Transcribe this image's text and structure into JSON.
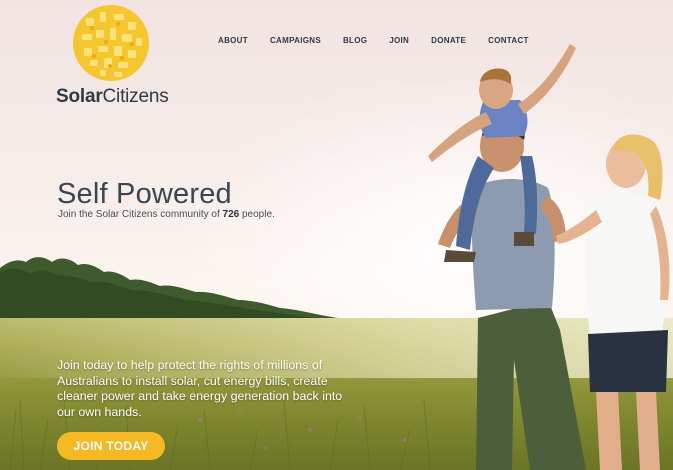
{
  "brand": {
    "name_bold": "Solar",
    "name_light": "Citizens",
    "accent_color": "#f5b823",
    "logo_icon": "sun-icon"
  },
  "nav": {
    "items": [
      {
        "label": "ABOUT"
      },
      {
        "label": "CAMPAIGNS"
      },
      {
        "label": "BLOG"
      },
      {
        "label": "JOIN"
      },
      {
        "label": "DONATE"
      },
      {
        "label": "CONTACT"
      }
    ]
  },
  "hero": {
    "title": "Self Powered",
    "subtitle_prefix": "Join the Solar Citizens community of ",
    "member_count": "726",
    "subtitle_suffix": " people."
  },
  "blurb": {
    "text": "Join today to help protect the rights of millions of Australians to install solar, cut energy bills, create cleaner power and take energy generation back into our own hands."
  },
  "cta": {
    "label": "JOIN TODAY"
  }
}
